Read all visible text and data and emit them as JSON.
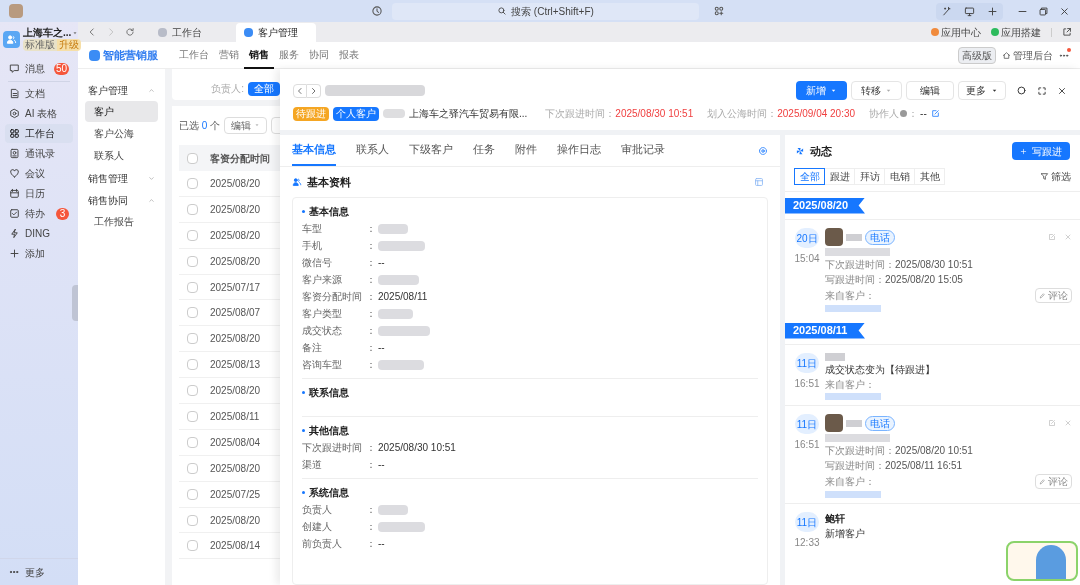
{
  "titlebar": {
    "search_placeholder": "搜索 (Ctrl+Shift+F)"
  },
  "org": {
    "name": "上海车之...",
    "edition": "标准版",
    "upgrade": "升级"
  },
  "sidebar": {
    "items": [
      {
        "label": "消息",
        "badge": "50",
        "selected": false
      },
      {
        "label": "文档",
        "selected": false
      },
      {
        "label": "AI 表格",
        "selected": false
      },
      {
        "label": "工作台",
        "selected": true
      },
      {
        "label": "通讯录",
        "selected": false
      },
      {
        "label": "会议",
        "selected": false
      },
      {
        "label": "日历",
        "selected": false
      },
      {
        "label": "待办",
        "badge": "3",
        "selected": false
      },
      {
        "label": "DING",
        "selected": false
      },
      {
        "label": "添加",
        "selected": false
      }
    ],
    "more": "更多"
  },
  "window_tabs": [
    {
      "label": "工作台",
      "selected": false
    },
    {
      "label": "客户管理",
      "selected": true
    }
  ],
  "top_links": [
    {
      "label": "应用中心"
    },
    {
      "label": "应用搭建"
    }
  ],
  "app": {
    "name": "智能营销服",
    "nav": [
      {
        "label": "工作台",
        "selected": false
      },
      {
        "label": "营销",
        "selected": false
      },
      {
        "label": "销售",
        "selected": true
      },
      {
        "label": "服务",
        "selected": false
      },
      {
        "label": "协同",
        "selected": false
      },
      {
        "label": "报表",
        "selected": false
      }
    ],
    "edition": "高级版",
    "admin": "管理后台"
  },
  "menu": [
    {
      "label": "客户管理",
      "expanded": true,
      "children": [
        {
          "label": "客户",
          "selected": true
        },
        {
          "label": "客户公海",
          "selected": false
        },
        {
          "label": "联系人",
          "selected": false
        }
      ]
    },
    {
      "label": "销售管理",
      "expanded": false
    },
    {
      "label": "销售协同",
      "expanded": true,
      "children": [
        {
          "label": "工作报告",
          "selected": false
        }
      ]
    }
  ],
  "list": {
    "filter_label": "负责人:",
    "filter_value": "全部",
    "selected_prefix": "已选",
    "selected_count": "0",
    "selected_suffix": "个",
    "edit_button": "编辑",
    "column": "客资分配时间",
    "select_all_checked": false,
    "rows": [
      {
        "value": "2025/08/20",
        "checked": false
      },
      {
        "value": "2025/08/20",
        "checked": false
      },
      {
        "value": "2025/08/20",
        "checked": false
      },
      {
        "value": "2025/08/20",
        "checked": false
      },
      {
        "value": "2025/07/17",
        "checked": false
      },
      {
        "value": "2025/08/07",
        "checked": false
      },
      {
        "value": "2025/08/20",
        "checked": false
      },
      {
        "value": "2025/08/13",
        "checked": false
      },
      {
        "value": "2025/08/20",
        "checked": false
      },
      {
        "value": "2025/08/11",
        "checked": false
      },
      {
        "value": "2025/08/04",
        "checked": false
      },
      {
        "value": "2025/08/20",
        "checked": false
      },
      {
        "value": "2025/07/25",
        "checked": false
      },
      {
        "value": "2025/08/20",
        "checked": false
      },
      {
        "value": "2025/08/14",
        "checked": false
      }
    ]
  },
  "detail": {
    "tags": [
      {
        "label": "待跟进",
        "color": "#f5a623"
      },
      {
        "label": "个人客户",
        "color": "#1677ff"
      }
    ],
    "company": "上海车之驿汽车贸易有限...",
    "meta": [
      {
        "label": "下次跟进时间：",
        "value": "2025/08/30 10:51"
      },
      {
        "label": "划入公海时间：",
        "value": "2025/09/04 20:30"
      }
    ],
    "collaborator": {
      "label": "协作人",
      "sep": "：",
      "value": "--"
    },
    "actions": [
      {
        "label": "新增",
        "kind": "primary"
      },
      {
        "label": "转移",
        "kind": "dropdown"
      },
      {
        "label": "编辑",
        "kind": "plain"
      },
      {
        "label": "更多",
        "kind": "menu"
      }
    ],
    "tabs": [
      {
        "label": "基本信息",
        "selected": true
      },
      {
        "label": "联系人",
        "selected": false
      },
      {
        "label": "下级客户",
        "selected": false
      },
      {
        "label": "任务",
        "selected": false
      },
      {
        "label": "附件",
        "selected": false
      },
      {
        "label": "操作日志",
        "selected": false
      },
      {
        "label": "审批记录",
        "selected": false
      }
    ],
    "section_title": "基本资料",
    "groups": [
      {
        "title": "基本信息",
        "fields": [
          {
            "label": "车型",
            "sep": "："
          },
          {
            "label": "手机",
            "sep": "："
          },
          {
            "label": "微信号",
            "sep": "：",
            "value": "--"
          },
          {
            "label": "客户来源",
            "sep": "："
          },
          {
            "label": "客资分配时间",
            "sep": "：",
            "value": "2025/08/11"
          },
          {
            "label": "客户类型",
            "sep": "："
          },
          {
            "label": "成交状态",
            "sep": "："
          },
          {
            "label": "备注",
            "sep": "：",
            "value": "--"
          },
          {
            "label": "咨询车型",
            "sep": "："
          }
        ]
      },
      {
        "title": "联系信息"
      },
      {
        "title": "其他信息",
        "fields": [
          {
            "label": "下次跟进时间",
            "sep": "：",
            "value": "2025/08/30 10:51"
          },
          {
            "label": "渠道",
            "sep": "：",
            "value": "--"
          }
        ]
      },
      {
        "title": "系统信息",
        "fields": [
          {
            "label": "负责人",
            "sep": "："
          },
          {
            "label": "创建人",
            "sep": "："
          },
          {
            "label": "前负责人",
            "sep": "：",
            "value": "--"
          }
        ]
      }
    ]
  },
  "activity": {
    "title": "动态",
    "write_button": "写跟进",
    "filter": "筛选",
    "filters": [
      {
        "label": "全部",
        "selected": true
      },
      {
        "label": "跟进",
        "selected": false
      },
      {
        "label": "拜访",
        "selected": false
      },
      {
        "label": "电销",
        "selected": false
      },
      {
        "label": "其他",
        "selected": false
      }
    ],
    "days": [
      {
        "date": "2025/08/20",
        "entries": [
          {
            "kind": "call",
            "day": "20日",
            "time": "15:04",
            "tag": "电话",
            "lines": [
              {
                "label": "下次跟进时间：",
                "value": "2025/08/30 10:51"
              },
              {
                "label": "写跟进时间：",
                "value": "2025/08/20 15:05"
              }
            ],
            "source_label": "来自客户：",
            "comment": "评论"
          }
        ]
      },
      {
        "date": "2025/08/11",
        "entries": [
          {
            "kind": "status",
            "day": "11日",
            "time": "16:51",
            "text": "成交状态变为【待跟进】",
            "source_label": "来自客户："
          },
          {
            "kind": "call",
            "day": "11日",
            "time": "16:51",
            "tag": "电话",
            "lines": [
              {
                "label": "下次跟进时间：",
                "value": "2025/08/20 10:51"
              },
              {
                "label": "写跟进时间：",
                "value": "2025/08/11 16:51"
              }
            ],
            "source_label": "来自客户：",
            "comment": "评论"
          },
          {
            "kind": "created",
            "day": "11日",
            "time": "12:33",
            "author": "鲍轩",
            "text": "新增客户"
          }
        ]
      }
    ]
  }
}
